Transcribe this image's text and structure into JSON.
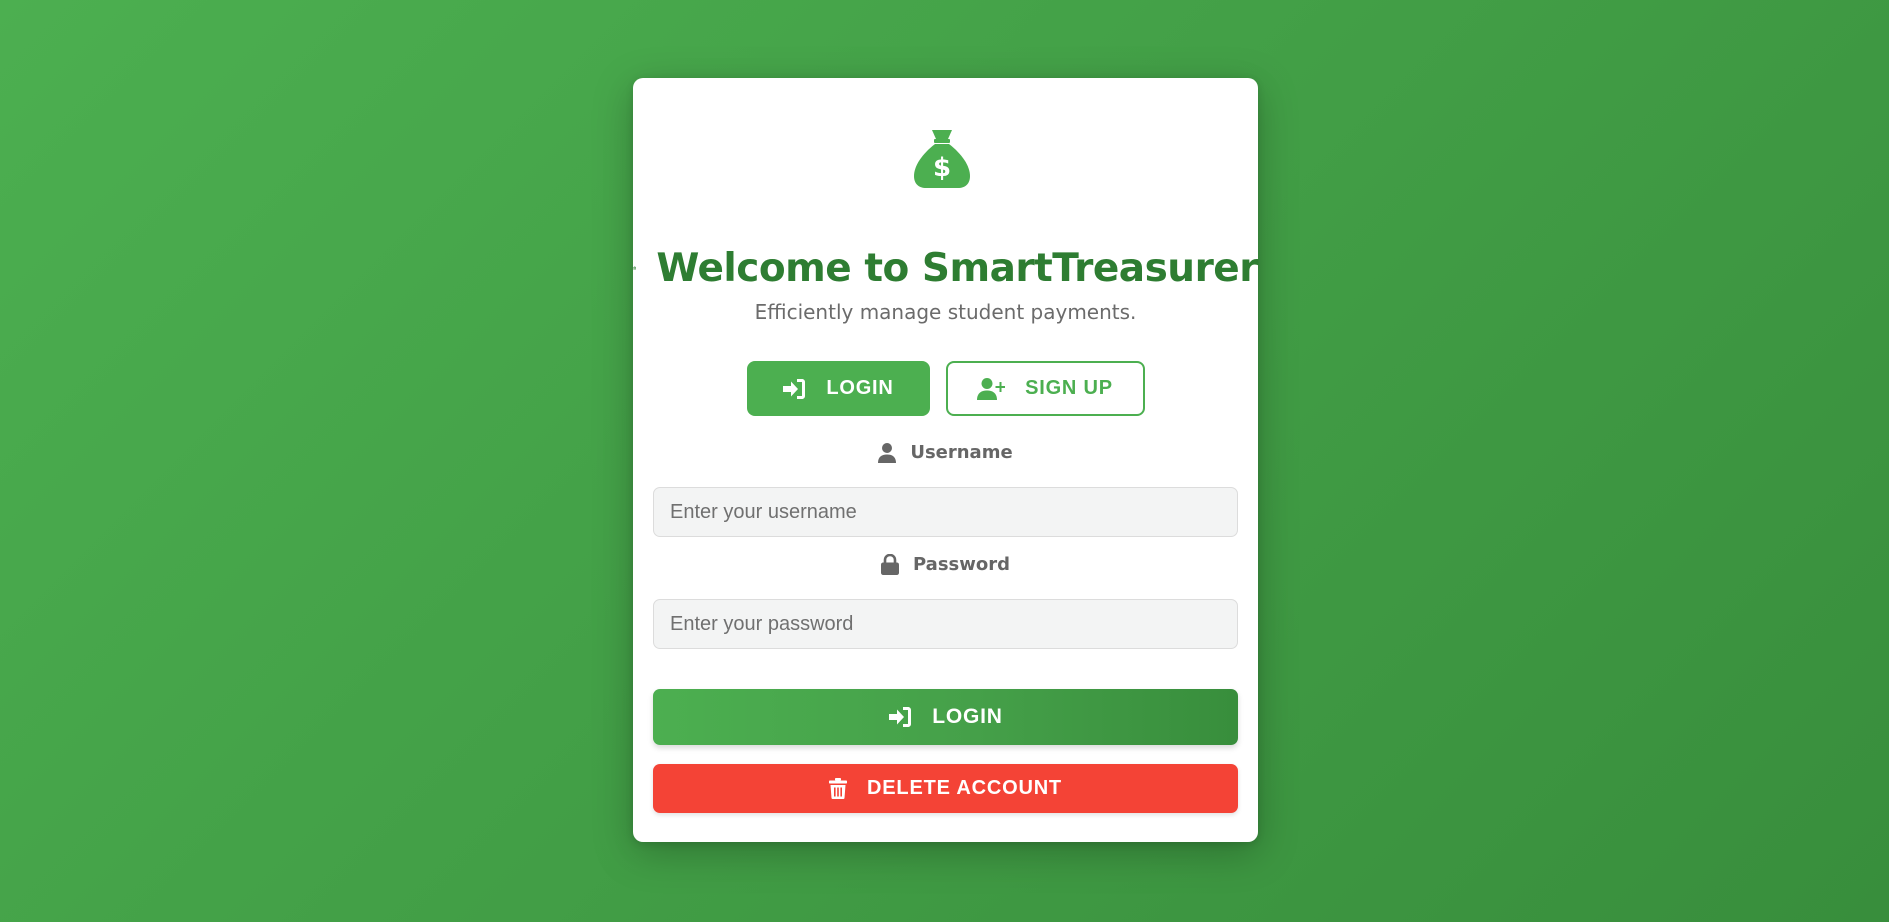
{
  "app": {
    "logo_icon": "money-bag-icon",
    "title_icon": "bank-icon",
    "title": "Welcome to SmartTreasurer",
    "subtitle": "Efficiently manage student payments."
  },
  "tabs": {
    "login_label": "LOGIN",
    "login_icon": "sign-in-icon",
    "signup_label": "SIGN UP",
    "signup_icon": "user-plus-icon"
  },
  "form": {
    "username_label": "Username",
    "username_icon": "user-icon",
    "username_placeholder": "Enter your username",
    "username_value": "",
    "password_label": "Password",
    "password_icon": "lock-icon",
    "password_placeholder": "Enter your password",
    "password_value": ""
  },
  "actions": {
    "login_label": "LOGIN",
    "login_icon": "sign-in-icon",
    "delete_label": "DELETE ACCOUNT",
    "delete_icon": "trash-icon"
  },
  "colors": {
    "primary": "#4caf50",
    "primary_dark": "#2e7d32",
    "danger": "#f44336",
    "background": "#43a047"
  }
}
